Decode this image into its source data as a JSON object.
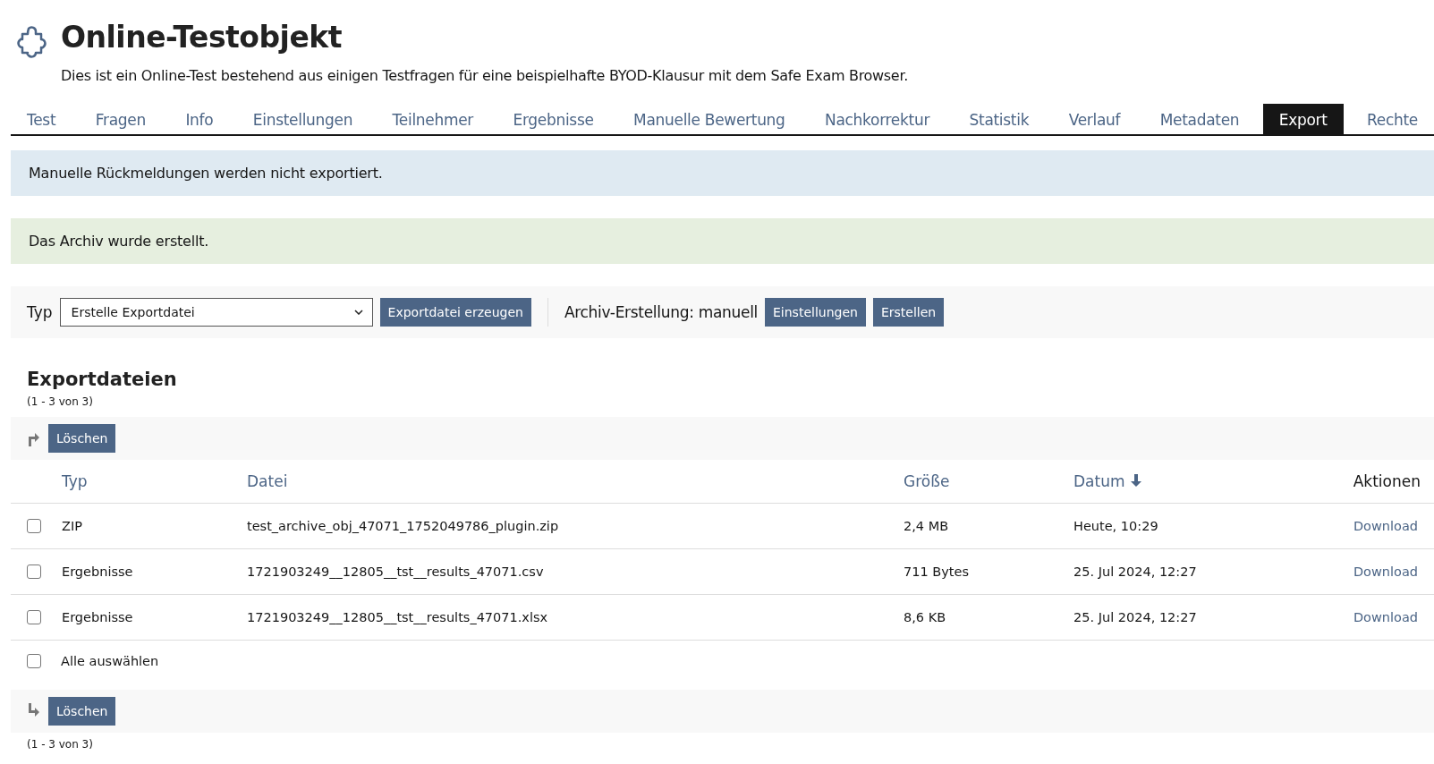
{
  "header": {
    "title": "Online-Testobjekt",
    "description": "Dies ist ein Online-Test bestehend aus einigen Testfragen für eine beispielhafte BYOD-Klausur mit dem Safe Exam Browser."
  },
  "tabs": [
    {
      "label": "Test",
      "selected": false
    },
    {
      "label": "Fragen",
      "selected": false
    },
    {
      "label": "Info",
      "selected": false
    },
    {
      "label": "Einstellungen",
      "selected": false
    },
    {
      "label": "Teilnehmer",
      "selected": false
    },
    {
      "label": "Ergebnisse",
      "selected": false
    },
    {
      "label": "Manuelle Bewertung",
      "selected": false
    },
    {
      "label": "Nachkorrektur",
      "selected": false
    },
    {
      "label": "Statistik",
      "selected": false
    },
    {
      "label": "Verlauf",
      "selected": false
    },
    {
      "label": "Metadaten",
      "selected": false
    },
    {
      "label": "Export",
      "selected": true
    },
    {
      "label": "Rechte",
      "selected": false
    }
  ],
  "messages": [
    {
      "kind": "info",
      "text": "Manuelle Rückmeldungen werden nicht exportiert."
    },
    {
      "kind": "success",
      "text": "Das Archiv wurde erstellt."
    }
  ],
  "toolbar": {
    "type_label": "Typ",
    "type_value": "Erstelle Exportdatei",
    "create_button": "Exportdatei erzeugen",
    "archive_label": "Archiv-Erstellung: manuell",
    "settings_button": "Einstellungen",
    "create_archive_button": "Erstellen"
  },
  "table": {
    "title": "Exportdateien",
    "count_top": "(1 - 3 von 3)",
    "delete_top": "Löschen",
    "columns": [
      {
        "label": "Typ",
        "sortable": true,
        "sorted": false
      },
      {
        "label": "Datei",
        "sortable": true,
        "sorted": false
      },
      {
        "label": "Größe",
        "sortable": true,
        "sorted": false
      },
      {
        "label": "Datum",
        "sortable": true,
        "sorted": true
      },
      {
        "label": "Aktionen",
        "sortable": false,
        "sorted": false
      }
    ],
    "rows": [
      {
        "checked": false,
        "type": "ZIP",
        "file": "test_archive_obj_47071_1752049786_plugin.zip",
        "size": "2,4 MB",
        "date": "Heute, 10:29",
        "action": "Download"
      },
      {
        "checked": false,
        "type": "Ergebnisse",
        "file": "1721903249__12805__tst__results_47071.csv",
        "size": "711 Bytes",
        "date": "25. Jul 2024, 12:27",
        "action": "Download"
      },
      {
        "checked": false,
        "type": "Ergebnisse",
        "file": "1721903249__12805__tst__results_47071.xlsx",
        "size": "8,6 KB",
        "date": "25. Jul 2024, 12:27",
        "action": "Download"
      }
    ],
    "select_all": {
      "label": "Alle auswählen",
      "checked": false
    },
    "delete_bottom": "Löschen",
    "count_bottom": "(1 - 3 von 3)"
  }
}
